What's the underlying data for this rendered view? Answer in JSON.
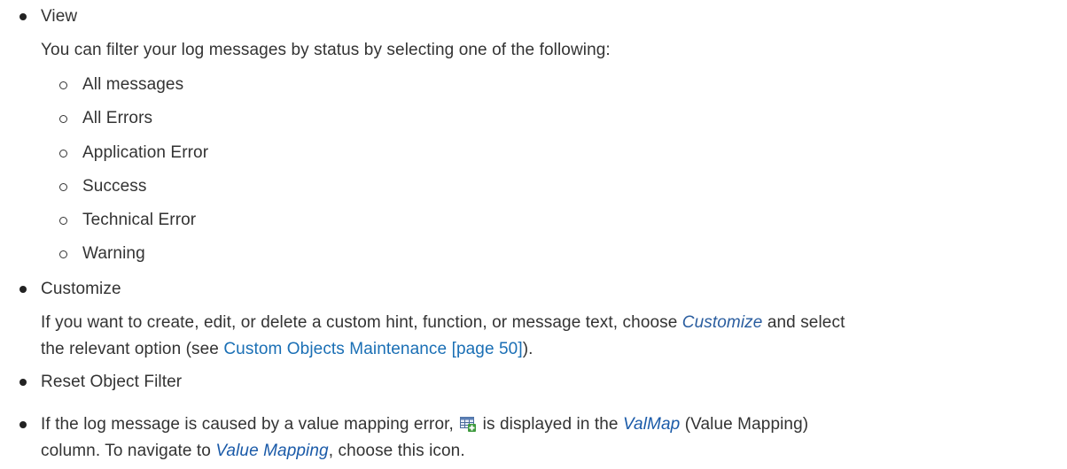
{
  "view": {
    "title": "View",
    "description": "You can filter your log messages by status by selecting one of the following:",
    "options": [
      "All messages",
      "All Errors",
      "Application Error",
      "Success",
      "Technical Error",
      "Warning"
    ]
  },
  "customize": {
    "title": "Customize",
    "line1_pre": "If you want to create, edit, or delete a custom hint, function, or message text, choose ",
    "line1_em": "Customize",
    "line1_post": " and select",
    "line2_pre": "the relevant option (see ",
    "line2_link": "Custom Objects Maintenance [page 50]",
    "line2_post": ")."
  },
  "reset": {
    "title": "Reset Object Filter"
  },
  "valmap": {
    "line1_pre": "If the log message is caused by a value mapping error,",
    "line1_mid": " is displayed in the ",
    "line1_em": "ValMap",
    "line1_post": " (Value Mapping)",
    "line2_pre": "column. To navigate to ",
    "line2_em": "Value Mapping",
    "line2_post": ", choose this icon.",
    "icon": "value-mapping-icon"
  }
}
